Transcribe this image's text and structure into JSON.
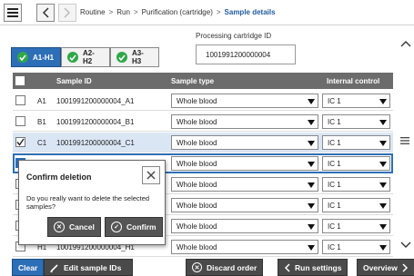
{
  "breadcrumb": {
    "items": [
      "Routine",
      "Run",
      "Purification (cartridge)"
    ],
    "current": "Sample details"
  },
  "processing_cartridge": {
    "label": "Processing cartridge ID",
    "value": "1001991200000004"
  },
  "tabs": [
    {
      "label": "A1-H1",
      "active": true
    },
    {
      "label": "A2-H2",
      "active": false
    },
    {
      "label": "A3-H3",
      "active": false
    }
  ],
  "table": {
    "headers": {
      "sample_id": "Sample ID",
      "sample_type": "Sample type",
      "internal_control": "Internal control"
    },
    "rows": [
      {
        "pos": "A1",
        "sample_id": "1001991200000004_A1",
        "sample_type": "Whole blood",
        "ic": "IC 1",
        "checked": false
      },
      {
        "pos": "B1",
        "sample_id": "1001991200000004_B1",
        "sample_type": "Whole blood",
        "ic": "IC 1",
        "checked": false
      },
      {
        "pos": "C1",
        "sample_id": "1001991200000004_C1",
        "sample_type": "Whole blood",
        "ic": "IC 1",
        "checked": true
      },
      {
        "pos": "",
        "sample_id": "",
        "sample_type": "Whole blood",
        "ic": "IC 1",
        "checked": true
      },
      {
        "pos": "",
        "sample_id": "",
        "sample_type": "Whole blood",
        "ic": "IC 1",
        "checked": false
      },
      {
        "pos": "",
        "sample_id": "",
        "sample_type": "Whole blood",
        "ic": "IC 1",
        "checked": false
      },
      {
        "pos": "",
        "sample_id": "",
        "sample_type": "Whole blood",
        "ic": "IC 1",
        "checked": false
      },
      {
        "pos": "",
        "sample_id": "",
        "sample_type": "Whole blood",
        "ic": "IC 1",
        "checked": false
      },
      {
        "pos": "H1",
        "sample_id": "1001991200000004_H1",
        "sample_type": "Whole blood",
        "ic": "IC 1",
        "checked": false
      }
    ]
  },
  "dialog": {
    "title": "Confirm deletion",
    "message": "Do you really want to delete the selected samples?",
    "cancel_label": "Cancel",
    "confirm_label": "Confirm"
  },
  "bottom": {
    "clear": "Clear",
    "edit": "Edit sample IDs",
    "discard": "Discard order",
    "run_settings": "Run settings",
    "overview": "Overview"
  },
  "colors": {
    "accent": "#2d6fb7",
    "header": "#6c6c6c",
    "check_green": "#2fa84a",
    "button_dark": "#4a4a4a"
  }
}
